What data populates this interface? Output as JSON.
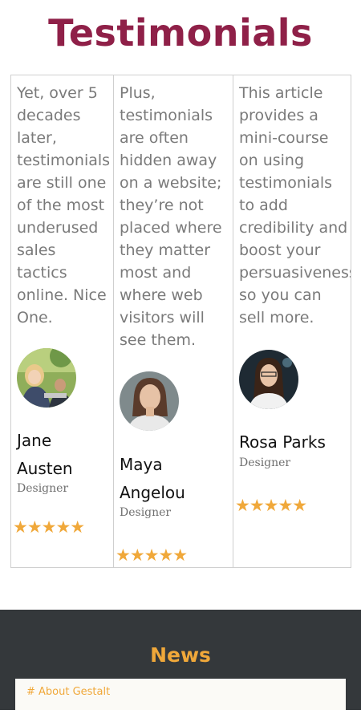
{
  "page": {
    "title": "Testimonials"
  },
  "testimonials": [
    {
      "quote": "Yet, over 5\ndecades\nlater,\ntestimonials\nare still one\nof the most\nunderused\nsales\ntactics\nonline. Nice\nOne.",
      "name": "Jane\nAusten",
      "role": "Designer",
      "stars": "★★★★★",
      "rating": 5
    },
    {
      "quote": "Plus,\ntestimonials\nare often\nhidden away\non a website;\nthey’re not\nplaced where\nthey matter\nmost and\nwhere web\nvisitors will\nsee them.",
      "name": "Maya\nAngelou",
      "role": "Designer",
      "stars": "★★★★★",
      "rating": 5
    },
    {
      "quote": "This article\nprovides a\nmini-course\non using\ntestimonials\nto add\ncredibility and\nboost your\npersuasiveness\nso you can\nsell more.",
      "name": "Rosa Parks",
      "role": "Designer",
      "stars": "★★★★★",
      "rating": 5
    }
  ],
  "news": {
    "title": "News",
    "items": [
      "# About Gestalt"
    ]
  },
  "colors": {
    "title": "#8f2048",
    "accent": "#f0a83a",
    "news_bg": "#34383b"
  }
}
